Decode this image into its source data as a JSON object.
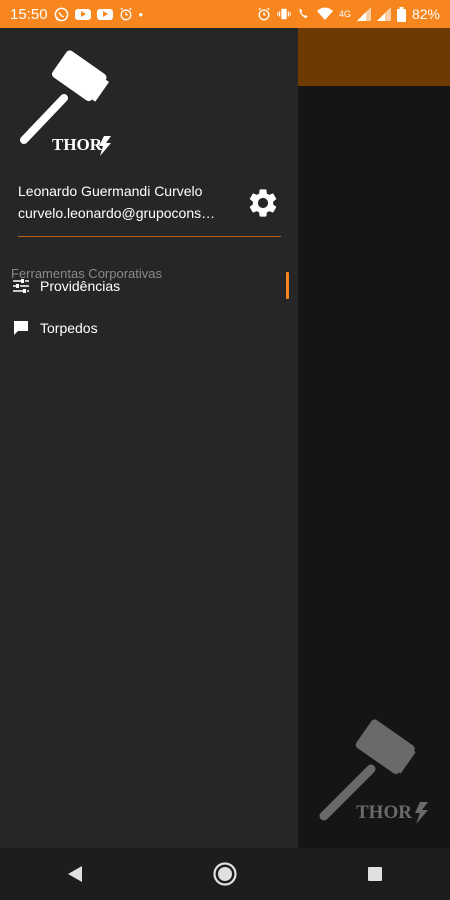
{
  "status_bar": {
    "time": "15:50",
    "battery": "82%",
    "network": "4G"
  },
  "drawer": {
    "logo_text": "THOR",
    "user_name": "Leonardo Guermandi Curvelo",
    "user_email": "curvelo.leonardo@grupocons…",
    "section_title": "Ferramentas Corporativas",
    "items": [
      {
        "label": "Providências",
        "icon": "tune-icon",
        "active": true
      },
      {
        "label": "Torpedos",
        "icon": "chat-icon",
        "active": false
      }
    ]
  },
  "background": {
    "logo_text": "THOR"
  },
  "colors": {
    "accent": "#f7861e",
    "drawer_bg": "#262626",
    "app_header": "#6e3a04",
    "app_bg": "#151515"
  }
}
